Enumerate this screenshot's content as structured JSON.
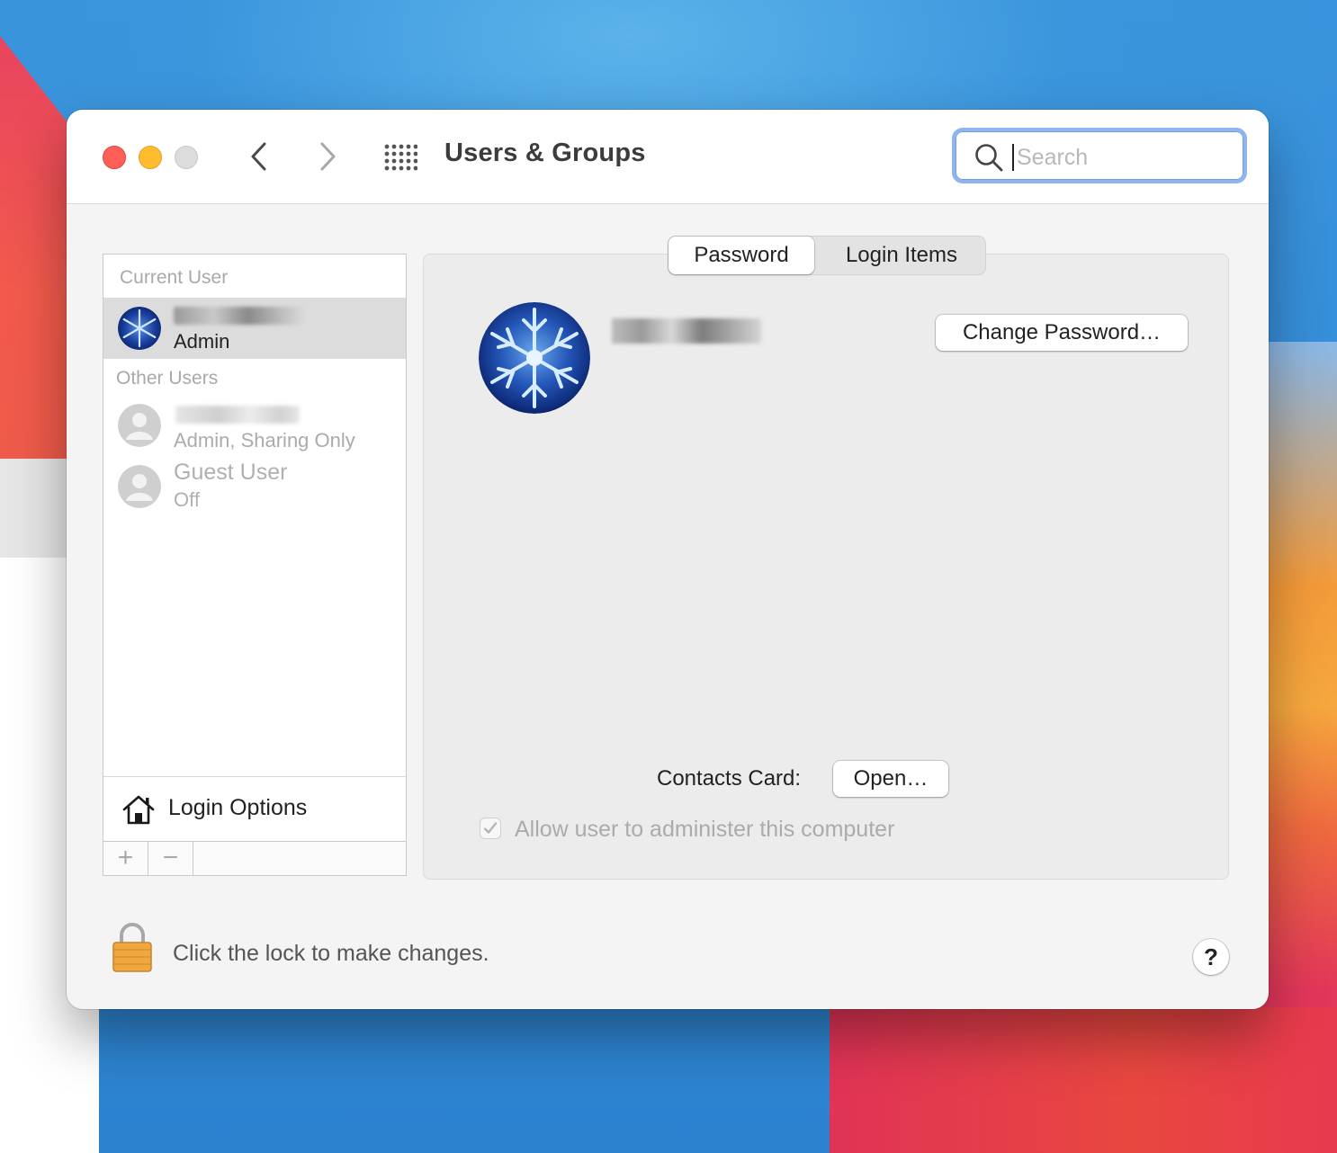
{
  "window": {
    "title": "Users & Groups"
  },
  "search": {
    "placeholder": "Search",
    "value": ""
  },
  "sidebar": {
    "current_user_header": "Current User",
    "current_user": {
      "role": "Admin"
    },
    "other_users_header": "Other Users",
    "other_users": [
      {
        "role": "Admin, Sharing Only"
      },
      {
        "name": "Guest User",
        "status": "Off"
      }
    ],
    "login_options_label": "Login Options",
    "add_label": "+",
    "remove_label": "−"
  },
  "tabs": [
    {
      "label": "Password",
      "active": true
    },
    {
      "label": "Login Items",
      "active": false
    }
  ],
  "detail": {
    "change_password_label": "Change Password…",
    "contacts_card_label": "Contacts Card:",
    "open_label": "Open…",
    "allow_admin_label": "Allow user to administer this computer",
    "allow_admin_checked": true
  },
  "footer": {
    "lock_label": "Click the lock to make changes.",
    "help_label": "?"
  },
  "colors": {
    "close": "#fe5f57",
    "minimize": "#febc2e",
    "zoom": "#dcdcdc",
    "search_focus_ring": "#8fb4ef",
    "selected_row": "#dcdcdc"
  },
  "icons": [
    "chevron-left-icon",
    "chevron-right-icon",
    "grid-icon",
    "search-icon",
    "house-icon",
    "lock-icon",
    "checkmark-icon",
    "generic-user-icon"
  ]
}
